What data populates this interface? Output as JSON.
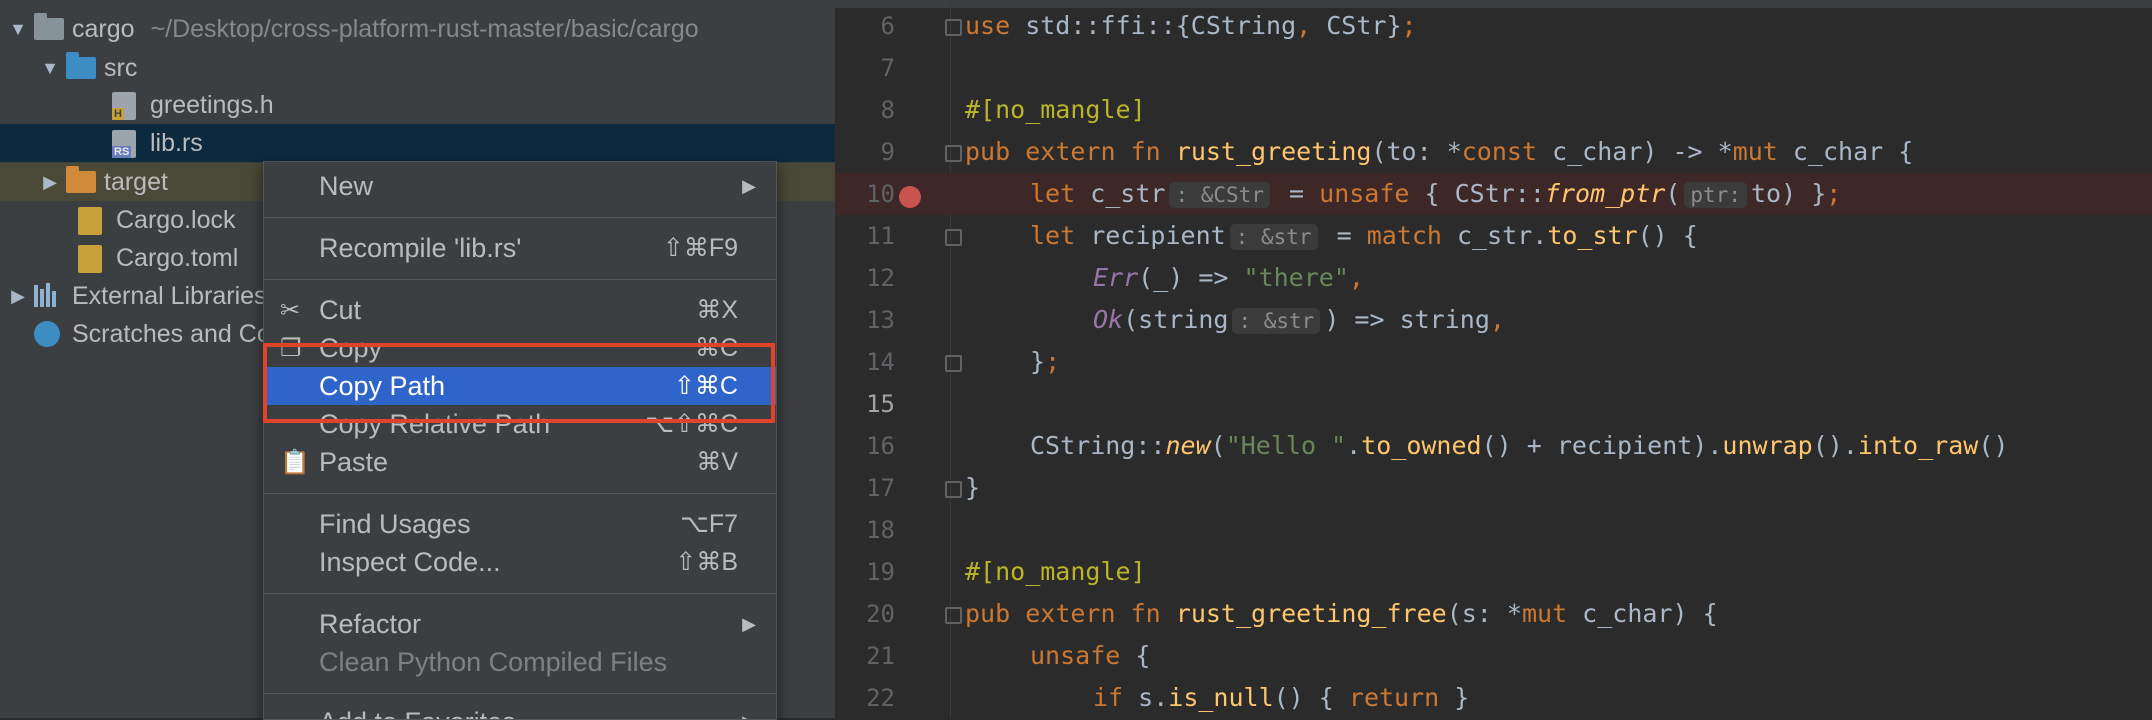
{
  "tree": {
    "root": {
      "name": "cargo",
      "path": "~/Desktop/cross-platform-rust-master/basic/cargo"
    },
    "src": "src",
    "greetings": "greetings.h",
    "lib": "lib.rs",
    "target": "target",
    "lock": "Cargo.lock",
    "toml": "Cargo.toml",
    "external": "External Libraries",
    "scratches": "Scratches and Consoles",
    "file_tags": {
      "h": "H",
      "rs": "RS"
    }
  },
  "menu": {
    "new": "New",
    "recompile": {
      "label": "Recompile 'lib.rs'",
      "shortcut": "⇧⌘F9"
    },
    "cut": {
      "label": "Cut",
      "shortcut": "⌘X"
    },
    "copy": {
      "label": "Copy",
      "shortcut": "⌘C"
    },
    "copy_path": {
      "label": "Copy Path",
      "shortcut": "⇧⌘C"
    },
    "copy_relative": {
      "label": "Copy Relative Path",
      "shortcut": "⌥⇧⌘C"
    },
    "paste": {
      "label": "Paste",
      "shortcut": "⌘V"
    },
    "find_usages": {
      "label": "Find Usages",
      "shortcut": "⌥F7"
    },
    "inspect": {
      "label": "Inspect Code...",
      "shortcut": "⇧⌘B"
    },
    "refactor": "Refactor",
    "clean": "Clean Python Compiled Files",
    "add_fav": "Add to Favorites"
  },
  "editor": {
    "line_numbers": [
      "6",
      "7",
      "8",
      "9",
      "10",
      "11",
      "12",
      "13",
      "14",
      "15",
      "16",
      "17",
      "18",
      "19",
      "20",
      "21",
      "22"
    ],
    "l6": {
      "kw": "use",
      "rest": " std::ffi::{CString",
      "comma": ",",
      "rest2": " CStr}",
      "semi": ";"
    },
    "l8": "#[no_mangle]",
    "l9": {
      "kw1": "pub",
      "kw2": "extern",
      "kw3": "fn",
      "name": "rust_greeting",
      "p1": "(to: *",
      "kw4": "const",
      "p2": " c_char) -> *",
      "kw5": "mut",
      "p3": " c_char {"
    },
    "l10": {
      "kw1": "let",
      "v": " c_str",
      "hint": ": &CStr",
      "eq": " = ",
      "kw2": "unsafe",
      "p1": " { CStr::",
      "f": "from_ptr",
      "p2": "(",
      "hint2": "ptr:",
      "p3": "to) }",
      "semi": ";"
    },
    "l11": {
      "kw1": "let",
      "v": " recipient",
      "hint": ": &str",
      "eq": " = ",
      "kw2": "match",
      "p1": " c_str.",
      "f": "to_str",
      "p2": "() {"
    },
    "l12": {
      "v": "Err",
      "p1": "(_) => ",
      "s": "\"there\"",
      "c": ","
    },
    "l13": {
      "v": "Ok",
      "p1": "(string",
      "hint": ": &str",
      "p2": ") => string",
      "c": ","
    },
    "l14": {
      "p": "}",
      "semi": ";"
    },
    "l16": {
      "p1": "CString::",
      "f1": "new",
      "p2": "(",
      "s": "\"Hello \"",
      "p3": ".",
      "f2": "to_owned",
      "p4": "() + recipient).",
      "f3": "unwrap",
      "p5": "().",
      "f4": "into_raw",
      "p6": "()"
    },
    "l17": "}",
    "l19": "#[no_mangle]",
    "l20": {
      "kw1": "pub",
      "kw2": "extern",
      "kw3": "fn",
      "name": "rust_greeting_free",
      "p1": "(s: *",
      "kw4": "mut",
      "p2": " c_char) {"
    },
    "l21": {
      "kw": "unsafe",
      "p": " {"
    },
    "l22": {
      "kw1": "if",
      "p1": " s.",
      "f": "is_null",
      "p2": "() { ",
      "kw2": "return",
      "p3": " }"
    }
  }
}
